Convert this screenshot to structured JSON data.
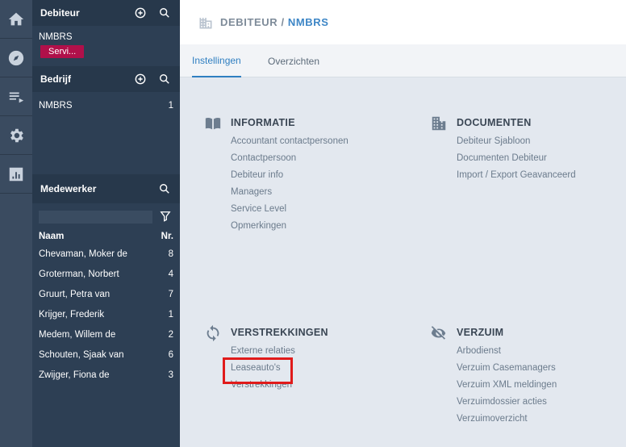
{
  "rail": {
    "icons": [
      "home-icon",
      "compass-icon",
      "playlist-icon",
      "gear-icon",
      "bar-chart-icon"
    ]
  },
  "sidebar": {
    "debiteur": {
      "title": "Debiteur",
      "item": "NMBRS",
      "badge": "Servi..."
    },
    "bedrijf": {
      "title": "Bedrijf",
      "items": [
        {
          "label": "NMBRS",
          "num": "1"
        }
      ]
    },
    "medewerker": {
      "title": "Medewerker",
      "filter_placeholder": "",
      "col_name": "Naam",
      "col_nr": "Nr.",
      "rows": [
        {
          "name": "Chevaman, Moker de",
          "nr": "8"
        },
        {
          "name": "Groterman, Norbert",
          "nr": "4"
        },
        {
          "name": "Gruurt, Petra van",
          "nr": "7"
        },
        {
          "name": "Krijger, Frederik",
          "nr": "1"
        },
        {
          "name": "Medem, Willem de",
          "nr": "2"
        },
        {
          "name": "Schouten, Sjaak van",
          "nr": "6"
        },
        {
          "name": "Zwijger, Fiona de",
          "nr": "3"
        }
      ]
    }
  },
  "header": {
    "crumb_root": "DEBITEUR",
    "crumb_sep": " / ",
    "crumb_current": "NMBRS"
  },
  "tabs": {
    "instellingen": "Instellingen",
    "overzichten": "Overzichten"
  },
  "sections": {
    "informatie": {
      "title": "INFORMATIE",
      "links": [
        "Accountant contactpersonen",
        "Contactpersoon",
        "Debiteur info",
        "Managers",
        "Service Level",
        "Opmerkingen"
      ]
    },
    "documenten": {
      "title": "DOCUMENTEN",
      "links": [
        "Debiteur Sjabloon",
        "Documenten Debiteur",
        "Import / Export Geavanceerd"
      ]
    },
    "verstrekkingen": {
      "title": "VERSTREKKINGEN",
      "links": [
        "Externe relaties",
        "Leaseauto's",
        "Verstrekkingen"
      ]
    },
    "verzuim": {
      "title": "VERZUIM",
      "links": [
        "Arbodienst",
        "Verzuim Casemanagers",
        "Verzuim XML meldingen",
        "Verzuimdossier acties",
        "Verzuimoverzicht"
      ]
    }
  },
  "colors": {
    "accent": "#2f7fc1",
    "badge": "#b0104a",
    "highlight_box": "#e01b1b"
  }
}
